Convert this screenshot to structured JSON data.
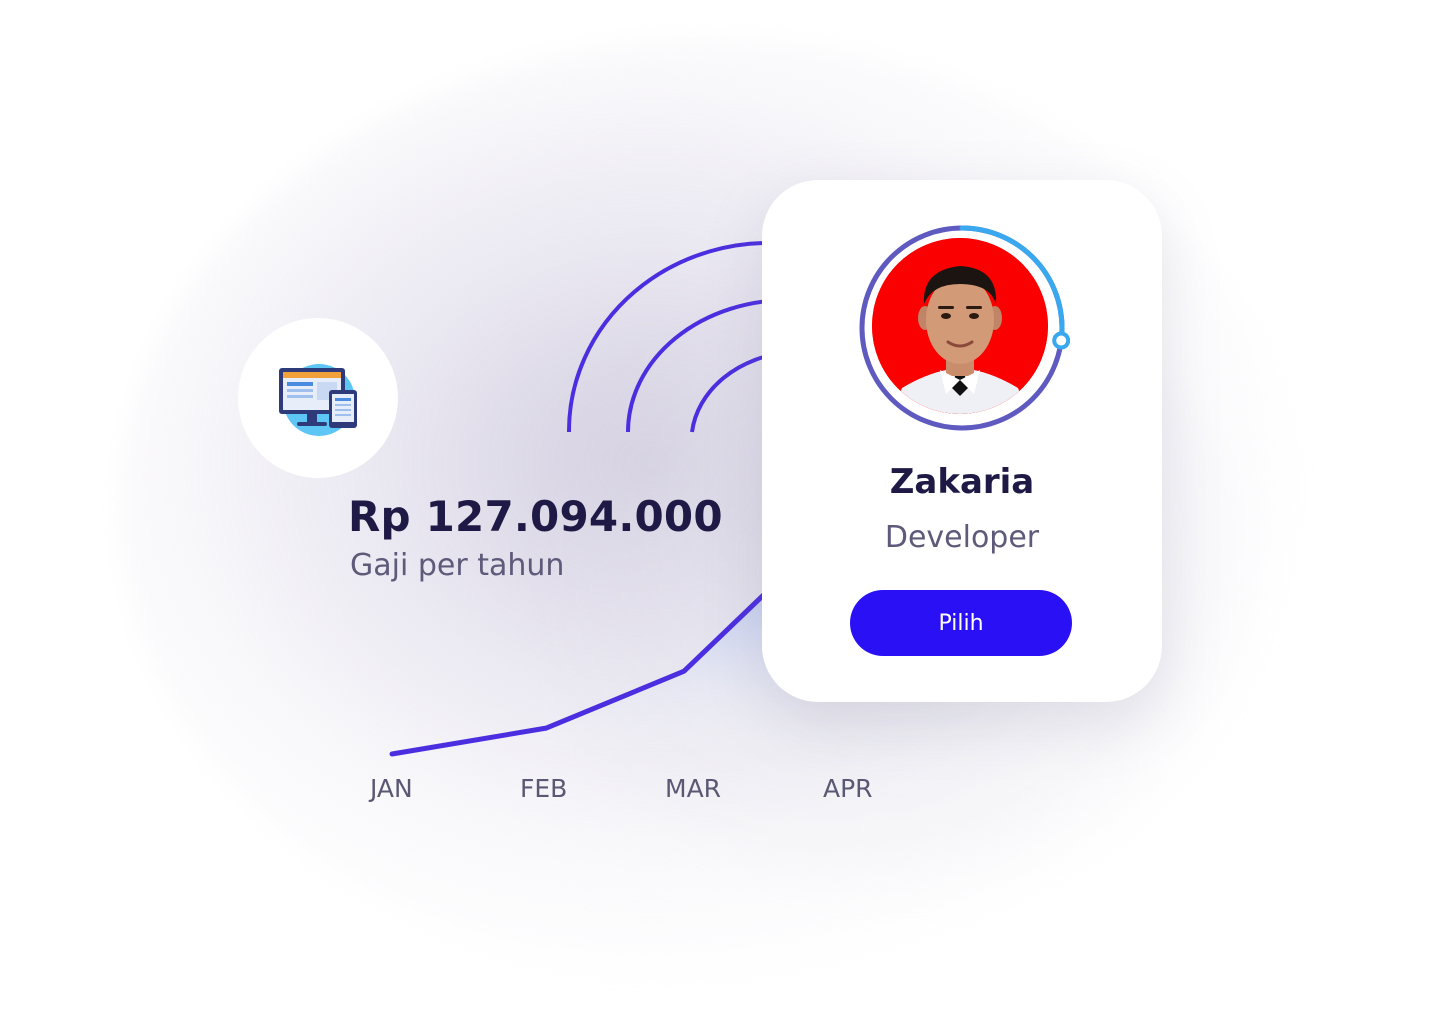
{
  "salary": {
    "amount": "Rp 127.094.000",
    "label": "Gaji per tahun"
  },
  "chart_data": {
    "type": "line",
    "categories": [
      "JAN",
      "FEB",
      "MAR",
      "APR"
    ],
    "series": [
      {
        "values": [
          0,
          10,
          32,
          75
        ]
      }
    ],
    "title": "",
    "xlabel": "",
    "ylabel": ""
  },
  "profile": {
    "name": "Zakaria",
    "role": "Developer",
    "button_label": "Pilih",
    "avatar_background": "#fb0000",
    "ring_progress": 0.27
  },
  "colors": {
    "accent": "#2a10f5",
    "line": "#4b2ee0",
    "ring": "#5e5ac0",
    "ring_highlight": "#3aa8ee",
    "text_dark": "#1f1a45",
    "text_muted": "#5e5a7a"
  },
  "icons": {
    "feature_icon": "monitor-tablet-icon"
  }
}
